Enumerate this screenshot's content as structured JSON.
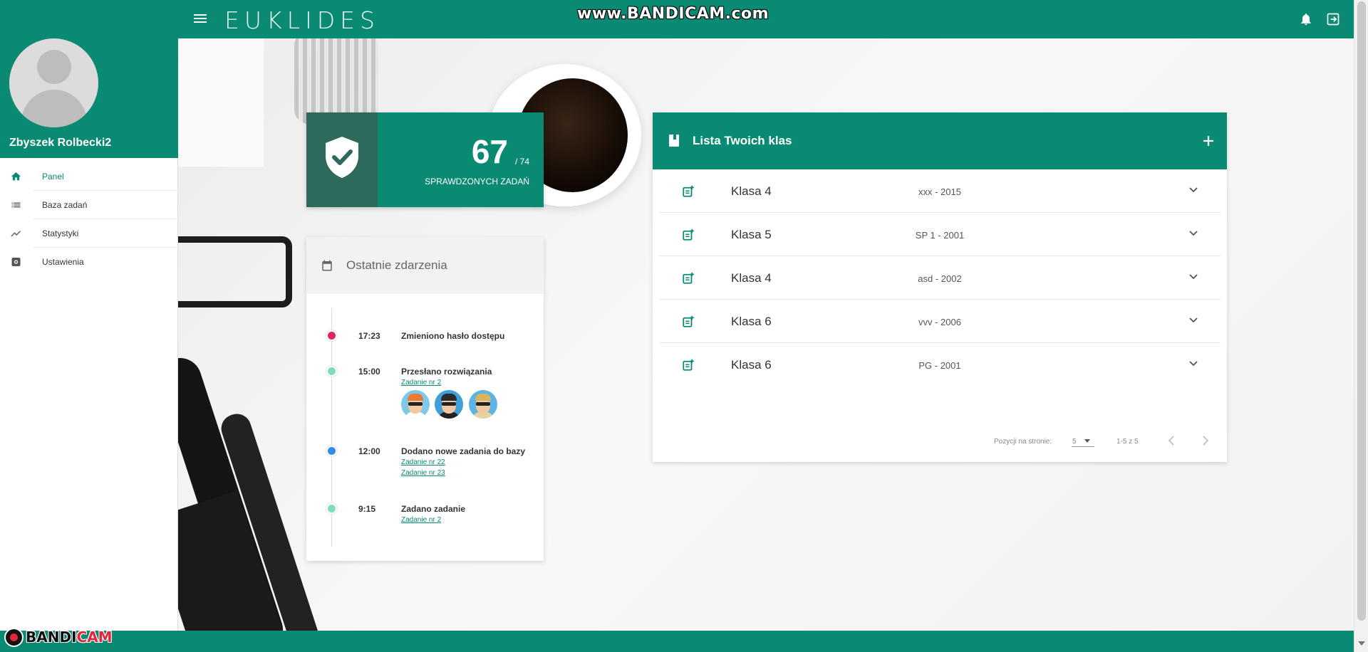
{
  "topbar": {
    "logo": "EUKLIDES",
    "watermark": "www.BANDICAM.com",
    "bell_icon": "bell-icon",
    "logout_icon": "logout-icon",
    "menu_icon": "hamburger-icon",
    "color": "#0b8a73"
  },
  "sidebar": {
    "user_name": "Zbyszek Rolbecki2",
    "items": [
      {
        "label": "Panel",
        "icon": "home-icon",
        "active": true
      },
      {
        "label": "Baza zadań",
        "icon": "list-icon",
        "active": false
      },
      {
        "label": "Statystyki",
        "icon": "trending-up-icon",
        "active": false
      },
      {
        "label": "Ustawienia",
        "icon": "settings-icon",
        "active": false
      }
    ]
  },
  "stat": {
    "value": "67",
    "total": "/ 74",
    "label": "SPRAWDZONYCH ZADAŃ",
    "icon": "shield-check-icon"
  },
  "events": {
    "title": "Ostatnie zdarzenia",
    "icon": "calendar-icon",
    "items": [
      {
        "time": "17:23",
        "title": "Zmieniono hasło dostępu",
        "dot_color": "#e0245e",
        "links": []
      },
      {
        "time": "15:00",
        "title": "Przesłano rozwiązania",
        "dot_color": "#7ddcc0",
        "links": [
          "Zadanie nr 2"
        ]
      },
      {
        "time": "12:00",
        "title": "Dodano nowe zadania do bazy",
        "dot_color": "#2e8ee6",
        "links": [
          "Zadanie nr 22",
          "Zadanie nr 23"
        ]
      },
      {
        "time": "9:15",
        "title": "Zadano zadanie",
        "dot_color": "#7ddcc0",
        "links": [
          "Zadanie nr 2"
        ]
      }
    ]
  },
  "classes": {
    "title": "Lista Twoich klas",
    "add_icon": "plus-icon",
    "rows": [
      {
        "name": "Klasa 4",
        "meta": "xxx - 2015"
      },
      {
        "name": "Klasa 5",
        "meta": "SP 1 - 2001"
      },
      {
        "name": "Klasa 4",
        "meta": "asd - 2002"
      },
      {
        "name": "Klasa 6",
        "meta": "vvv - 2006"
      },
      {
        "name": "Klasa 6",
        "meta": "PG - 2001"
      }
    ],
    "pager": {
      "label": "Pozycji na stronie:",
      "per_page": "5",
      "range": "1-5 z 5"
    }
  },
  "footer": {
    "bandicam_black": "BANDI",
    "bandicam_red": "CAM"
  }
}
